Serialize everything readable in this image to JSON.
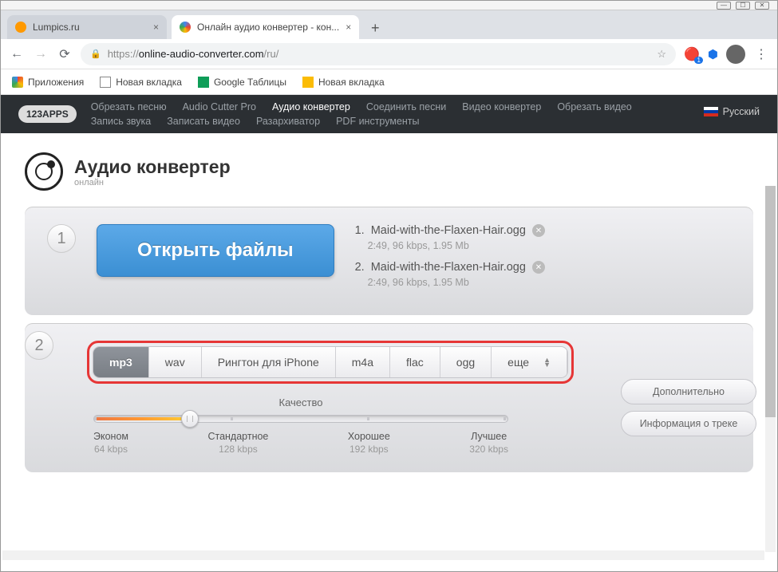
{
  "window": {
    "min": "—",
    "max": "☐",
    "close": "✕"
  },
  "tabs": [
    {
      "title": "Lumpics.ru"
    },
    {
      "title": "Онлайн аудио конвертер - кон..."
    }
  ],
  "newtab": "+",
  "url": {
    "https": "https://",
    "host": "online-audio-converter.com",
    "path": "/ru/"
  },
  "bookmarks": {
    "apps": "Приложения",
    "b1": "Новая вкладка",
    "b2": "Google Таблицы",
    "b3": "Новая вкладка"
  },
  "nav": {
    "logo": "123APPS",
    "links": [
      "Обрезать песню",
      "Audio Cutter Pro",
      "Аудио конвертер",
      "Соединить песни",
      "Видео конвертер",
      "Обрезать видео",
      "Запись звука",
      "Записать видео",
      "Разархиватор",
      "PDF инструменты"
    ],
    "active_index": 2,
    "lang": "Русский"
  },
  "head": {
    "title": "Аудио конвертер",
    "sub": "онлайн"
  },
  "step1": {
    "num": "1",
    "open": "Открыть файлы",
    "files": [
      {
        "idx": "1.",
        "name": "Maid-with-the-Flaxen-Hair.ogg",
        "info": "2:49, 96 kbps, 1.95 Mb"
      },
      {
        "idx": "2.",
        "name": "Maid-with-the-Flaxen-Hair.ogg",
        "info": "2:49, 96 kbps, 1.95 Mb"
      }
    ]
  },
  "step2": {
    "num": "2",
    "formats": [
      "mp3",
      "wav",
      "Рингтон для iPhone",
      "m4a",
      "flac",
      "ogg",
      "еще"
    ],
    "quality_label": "Качество",
    "stops": [
      {
        "label": "Эконом",
        "kbps": "64 kbps"
      },
      {
        "label": "Стандартное",
        "kbps": "128 kbps"
      },
      {
        "label": "Хорошее",
        "kbps": "192 kbps"
      },
      {
        "label": "Лучшее",
        "kbps": "320 kbps"
      }
    ],
    "side": [
      "Дополнительно",
      "Информация о треке"
    ]
  }
}
